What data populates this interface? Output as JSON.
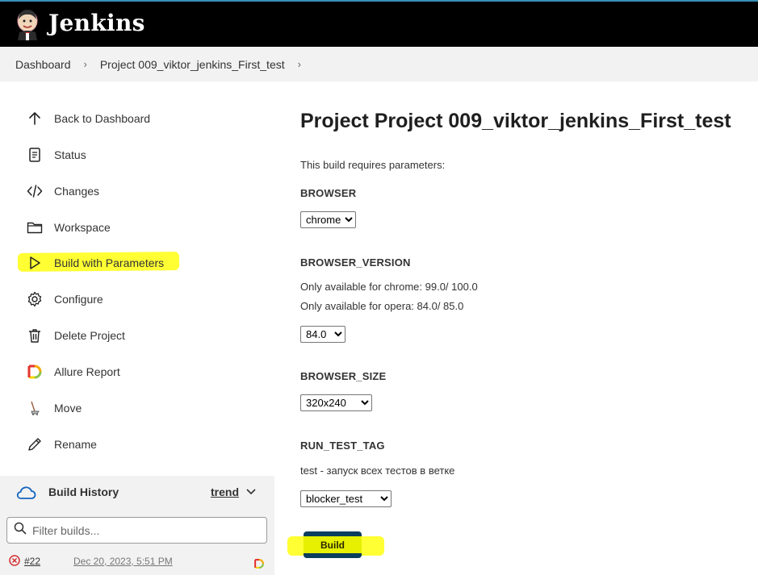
{
  "header": {
    "brand": "Jenkins"
  },
  "breadcrumb": {
    "items": [
      "Dashboard",
      "Project 009_viktor_jenkins_First_test"
    ]
  },
  "sidebar": {
    "items": [
      {
        "label": "Back to Dashboard",
        "icon": "arrow-up-icon"
      },
      {
        "label": "Status",
        "icon": "document-icon"
      },
      {
        "label": "Changes",
        "icon": "code-icon"
      },
      {
        "label": "Workspace",
        "icon": "folder-icon"
      },
      {
        "label": "Build with Parameters",
        "icon": "play-icon"
      },
      {
        "label": "Configure",
        "icon": "gear-icon"
      },
      {
        "label": "Delete Project",
        "icon": "trash-icon"
      },
      {
        "label": "Allure Report",
        "icon": "allure-icon"
      },
      {
        "label": "Move",
        "icon": "move-icon"
      },
      {
        "label": "Rename",
        "icon": "pencil-icon"
      }
    ]
  },
  "build_history": {
    "title": "Build History",
    "trend": "trend",
    "filter_placeholder": "Filter builds...",
    "builds": [
      {
        "number": "#22",
        "date": "Dec 20, 2023, 5:51 PM",
        "status": "failed"
      }
    ]
  },
  "main": {
    "title": "Project Project 009_viktor_jenkins_First_test",
    "requires": "This build requires parameters:",
    "params": {
      "browser": {
        "name": "BROWSER",
        "value": "chrome"
      },
      "browser_version": {
        "name": "BROWSER_VERSION",
        "desc1": "Only available for chrome: 99.0/ 100.0",
        "desc2": "Only available for opera: 84.0/ 85.0",
        "value": "84.0"
      },
      "browser_size": {
        "name": "BROWSER_SIZE",
        "value": "320x240"
      },
      "run_test_tag": {
        "name": "RUN_TEST_TAG",
        "desc": "test - запуск всех тестов в ветке",
        "value": "blocker_test"
      }
    },
    "build_button": "Build"
  },
  "colors": {
    "header_bg": "#000000",
    "highlight": "#ffff33",
    "build_button": "#0b3d5c",
    "panel_bg": "#f2f2f2"
  }
}
